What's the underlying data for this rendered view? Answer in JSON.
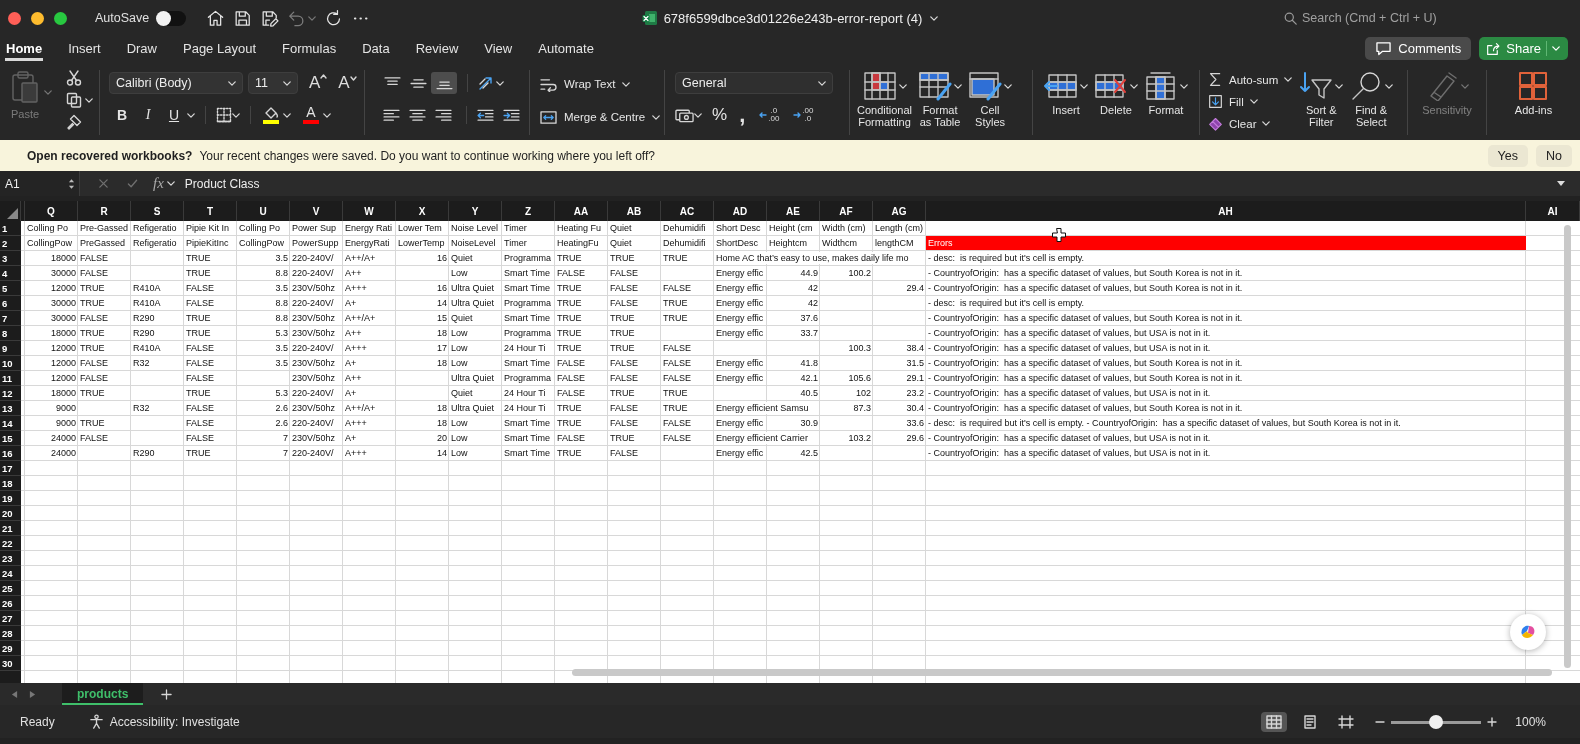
{
  "window": {
    "title": "678f6599dbce3d01226e243b-error-report (4)",
    "autosave": {
      "label": "AutoSave",
      "on": false
    },
    "search": {
      "placeholder": "Search (Cmd + Ctrl + U)"
    }
  },
  "quick_access": [
    {
      "kind": "home",
      "disabled": false
    },
    {
      "kind": "save",
      "disabled": false
    },
    {
      "kind": "save-edit",
      "disabled": false
    },
    {
      "kind": "undo",
      "disabled": true
    },
    {
      "kind": "redo",
      "disabled": false
    },
    {
      "kind": "more",
      "disabled": false
    }
  ],
  "tabs": [
    {
      "label": "Home",
      "selected": true
    },
    {
      "label": "Insert",
      "selected": false
    },
    {
      "label": "Draw",
      "selected": false
    },
    {
      "label": "Page Layout",
      "selected": false
    },
    {
      "label": "Formulas",
      "selected": false
    },
    {
      "label": "Data",
      "selected": false
    },
    {
      "label": "Review",
      "selected": false
    },
    {
      "label": "View",
      "selected": false
    },
    {
      "label": "Automate",
      "selected": false
    }
  ],
  "header_buttons": [
    {
      "kind": "comments",
      "label": "Comments"
    },
    {
      "kind": "share",
      "label": "Share"
    }
  ],
  "ribbon": {
    "paste": {
      "label": "Paste",
      "disabled": true
    },
    "font": {
      "name": "Calibri (Body)",
      "size": "11",
      "size_buttons": [
        {
          "kind": "grow",
          "glyph": "A"
        },
        {
          "kind": "shrink",
          "glyph": "A"
        }
      ],
      "styles": [
        {
          "kind": "bold",
          "glyph": "B"
        },
        {
          "kind": "italic",
          "glyph": "I"
        },
        {
          "kind": "underline",
          "glyph": "U"
        }
      ],
      "fill": {
        "color": "#ffff00"
      },
      "font_color": {
        "glyph": "A",
        "color": "#ff0000"
      }
    },
    "alignment": {
      "vertical": [
        {
          "kind": "top",
          "selected": false
        },
        {
          "kind": "middle",
          "selected": false
        },
        {
          "kind": "bottom",
          "selected": true
        }
      ],
      "horizontal": [
        {
          "kind": "left",
          "selected": false
        },
        {
          "kind": "center",
          "selected": false
        },
        {
          "kind": "right",
          "selected": false
        }
      ]
    },
    "wrap_text": {
      "label": "Wrap Text"
    },
    "merge": {
      "label": "Merge & Centre"
    },
    "number": {
      "format": "General",
      "percent": "%",
      "comma": ",",
      "decimals": [
        {
          "kind": "increase",
          "lines": [
            ".0",
            ".00"
          ]
        },
        {
          "kind": "decrease",
          "lines": [
            ".00",
            ".0"
          ]
        }
      ]
    },
    "styles": [
      {
        "kind": "conditional",
        "lines": [
          "Conditional",
          "Formatting"
        ]
      },
      {
        "kind": "table",
        "lines": [
          "Format",
          "as Table"
        ]
      },
      {
        "kind": "cell-styles",
        "lines": [
          "Cell",
          "Styles"
        ]
      }
    ],
    "cells": [
      {
        "kind": "insert",
        "label": "Insert"
      },
      {
        "kind": "delete",
        "label": "Delete"
      },
      {
        "kind": "format",
        "label": "Format"
      }
    ],
    "editing": [
      {
        "kind": "autosum",
        "label": "Auto-sum"
      },
      {
        "kind": "fill",
        "label": "Fill"
      },
      {
        "kind": "clear",
        "label": "Clear"
      }
    ],
    "find": [
      {
        "kind": "sort",
        "lines": [
          "Sort &",
          "Filter"
        ]
      },
      {
        "kind": "find",
        "lines": [
          "Find &",
          "Select"
        ]
      }
    ],
    "sensitivity": {
      "label": "Sensitivity",
      "disabled": true
    },
    "addins": {
      "label": "Add-ins"
    }
  },
  "notice": {
    "title": "Open recovered workbooks?",
    "message": "Your recent changes were saved. Do you want to continue working where you left off?",
    "buttons": [
      "Yes",
      "No"
    ]
  },
  "formula_bar": {
    "cell": "A1",
    "function_label": "fx",
    "value": "Product Class"
  },
  "sheet": {
    "columns": [
      {
        "letter": "Q",
        "kind": "number"
      },
      {
        "letter": "R",
        "kind": "text"
      },
      {
        "letter": "S",
        "kind": "text"
      },
      {
        "letter": "T",
        "kind": "text"
      },
      {
        "letter": "U",
        "kind": "number"
      },
      {
        "letter": "V",
        "kind": "text"
      },
      {
        "letter": "W",
        "kind": "text"
      },
      {
        "letter": "X",
        "kind": "number"
      },
      {
        "letter": "Y",
        "kind": "text"
      },
      {
        "letter": "Z",
        "kind": "text"
      },
      {
        "letter": "AA",
        "kind": "text"
      },
      {
        "letter": "AB",
        "kind": "text"
      },
      {
        "letter": "AC",
        "kind": "text"
      },
      {
        "letter": "AD",
        "kind": "text"
      },
      {
        "letter": "AE",
        "kind": "number"
      },
      {
        "letter": "AF",
        "kind": "number"
      },
      {
        "letter": "AG",
        "kind": "number"
      },
      {
        "letter": "AH",
        "kind": "text"
      },
      {
        "letter": "AI",
        "kind": "text"
      }
    ],
    "header_rows": [
      {
        "number": "1",
        "last_cell_highlighted": false,
        "cells": [
          "Colling Po",
          "Pre-Gassed",
          "Refigeratio",
          "Pipie Kit In",
          "Colling Po",
          "Power Sup",
          "Energy Rati",
          "Lower Tem",
          "Noise Level",
          "Timer",
          "Heating Fu",
          "Quiet",
          "Dehumidifi",
          "Short Desc",
          "Height (cm",
          "Width (cm)",
          "Length (cm)",
          null
        ]
      },
      {
        "number": "2",
        "last_cell_highlighted": true,
        "cells": [
          "CollingPow",
          "PreGassed",
          "Refigeratio",
          "PipieKitInc",
          "CollingPow",
          "PowerSupp",
          "EnergyRati",
          "LowerTemp",
          "NoiseLevel",
          "Timer",
          "HeatingFu",
          "Quiet",
          "Dehumidifi",
          "ShortDesc",
          "Heightcm",
          "Widthcm",
          "lengthCM",
          "Errors"
        ]
      }
    ],
    "rows": [
      {
        "number": "3",
        "cells": [
          "18000",
          "FALSE",
          null,
          "TRUE",
          "3.5",
          "220-240V/",
          "A++/A+",
          "16",
          "Quiet",
          "Programma",
          "TRUE",
          "TRUE",
          "TRUE",
          "Home AC that’s easy to use, makes daily life mo",
          null,
          null,
          null,
          "- desc:  is required but it's cell is empty."
        ]
      },
      {
        "number": "4",
        "cells": [
          "30000",
          "FALSE",
          null,
          "TRUE",
          "8.8",
          "220-240V/",
          "A++",
          null,
          "Low",
          "Smart Time",
          "FALSE",
          "FALSE",
          null,
          "Energy effic",
          "44.9",
          "100.2",
          null,
          "- CountryofOrigin:  has a specific dataset of values, but South Korea is not in it."
        ]
      },
      {
        "number": "5",
        "cells": [
          "12000",
          "TRUE",
          "R410A",
          "FALSE",
          "3.5",
          "230V/50hz",
          "A+++",
          "16",
          "Ultra Quiet",
          "Smart Time",
          "TRUE",
          "FALSE",
          "FALSE",
          "Energy effic",
          "42",
          null,
          "29.4",
          "- CountryofOrigin:  has a specific dataset of values, but South Korea is not in it."
        ]
      },
      {
        "number": "6",
        "cells": [
          "30000",
          "TRUE",
          "R410A",
          "FALSE",
          "8.8",
          "220-240V/",
          "A+",
          "14",
          "Ultra Quiet",
          "Programma",
          "TRUE",
          "FALSE",
          "TRUE",
          "Energy effic",
          "42",
          null,
          null,
          "- desc:  is required but it's cell is empty."
        ]
      },
      {
        "number": "7",
        "cells": [
          "30000",
          "FALSE",
          "R290",
          "TRUE",
          "8.8",
          "230V/50hz",
          "A++/A+",
          "15",
          "Quiet",
          "Smart Time",
          "TRUE",
          "TRUE",
          "TRUE",
          "Energy effic",
          "37.6",
          null,
          null,
          "- CountryofOrigin:  has a specific dataset of values, but South Korea is not in it."
        ]
      },
      {
        "number": "8",
        "cells": [
          "18000",
          "TRUE",
          "R290",
          "TRUE",
          "5.3",
          "230V/50hz",
          "A++",
          "18",
          "Low",
          "Programma",
          "TRUE",
          "TRUE",
          null,
          "Energy effic",
          "33.7",
          null,
          null,
          "- CountryofOrigin:  has a specific dataset of values, but USA is not in it."
        ]
      },
      {
        "number": "9",
        "cells": [
          "12000",
          "TRUE",
          "R410A",
          "FALSE",
          "3.5",
          "220-240V/",
          "A+++",
          "17",
          "Low",
          "24 Hour Ti",
          "TRUE",
          "TRUE",
          "FALSE",
          null,
          null,
          "100.3",
          "38.4",
          "- CountryofOrigin:  has a specific dataset of values, but USA is not in it."
        ]
      },
      {
        "number": "10",
        "cells": [
          "12000",
          "FALSE",
          "R32",
          "FALSE",
          "3.5",
          "230V/50hz",
          "A+",
          "18",
          "Low",
          "Smart Time",
          "FALSE",
          "FALSE",
          "FALSE",
          "Energy effic",
          "41.8",
          null,
          "31.5",
          "- CountryofOrigin:  has a specific dataset of values, but South Korea is not in it."
        ]
      },
      {
        "number": "11",
        "cells": [
          "12000",
          "FALSE",
          null,
          "FALSE",
          null,
          "230V/50hz",
          "A++",
          null,
          "Ultra Quiet",
          "Programma",
          "FALSE",
          "FALSE",
          "FALSE",
          "Energy effic",
          "42.1",
          "105.6",
          "29.1",
          "- CountryofOrigin:  has a specific dataset of values, but South Korea is not in it."
        ]
      },
      {
        "number": "12",
        "cells": [
          "18000",
          "TRUE",
          null,
          "TRUE",
          "5.3",
          "220-240V/",
          "A+",
          null,
          "Quiet",
          "24 Hour Ti",
          "FALSE",
          "TRUE",
          "TRUE",
          null,
          "40.5",
          "102",
          "23.2",
          "- CountryofOrigin:  has a specific dataset of values, but USA is not in it."
        ]
      },
      {
        "number": "13",
        "cells": [
          "9000",
          null,
          "R32",
          "FALSE",
          "2.6",
          "230V/50hz",
          "A++/A+",
          "18",
          "Ultra Quiet",
          "24 Hour Ti",
          "TRUE",
          "FALSE",
          "TRUE",
          "Energy efficient Samsu",
          null,
          "87.3",
          "30.4",
          "- CountryofOrigin:  has a specific dataset of values, but South Korea is not in it."
        ]
      },
      {
        "number": "14",
        "cells": [
          "9000",
          "TRUE",
          null,
          "FALSE",
          "2.6",
          "220-240V/",
          "A+++",
          "18",
          "Low",
          "Smart Time",
          "TRUE",
          "FALSE",
          "FALSE",
          "Energy effic",
          "30.9",
          null,
          "33.6",
          "- desc:  is required but it's cell is empty. - CountryofOrigin:  has a specific dataset of values, but South Korea is not in it."
        ]
      },
      {
        "number": "15",
        "cells": [
          "24000",
          "FALSE",
          null,
          "FALSE",
          "7",
          "230V/50hz",
          "A+",
          "20",
          "Low",
          "Smart Time",
          "FALSE",
          "TRUE",
          "FALSE",
          "Energy efficient Carrier",
          null,
          "103.2",
          "29.6",
          "- CountryofOrigin:  has a specific dataset of values, but USA is not in it."
        ]
      },
      {
        "number": "16",
        "cells": [
          "24000",
          null,
          "R290",
          "TRUE",
          "7",
          "220-240V/",
          "A+++",
          "14",
          "Low",
          "Smart Time",
          "TRUE",
          "FALSE",
          null,
          "Energy effic",
          "42.5",
          null,
          null,
          "- CountryofOrigin:  has a specific dataset of values, but USA is not in it."
        ]
      }
    ],
    "empty_rows": [
      "17",
      "18",
      "19",
      "20",
      "21",
      "22",
      "23",
      "24",
      "25",
      "26",
      "27",
      "28",
      "29",
      "30"
    ]
  },
  "sheet_tabs": [
    {
      "label": "products",
      "selected": true
    }
  ],
  "status_bar": {
    "status": "Ready",
    "accessibility": "Accessibility: Investigate",
    "views": [
      {
        "kind": "normal",
        "selected": true
      },
      {
        "kind": "page-layout",
        "selected": false
      },
      {
        "kind": "page-break",
        "selected": false
      }
    ],
    "zoom": {
      "level": 0.5,
      "label": "100%"
    }
  }
}
